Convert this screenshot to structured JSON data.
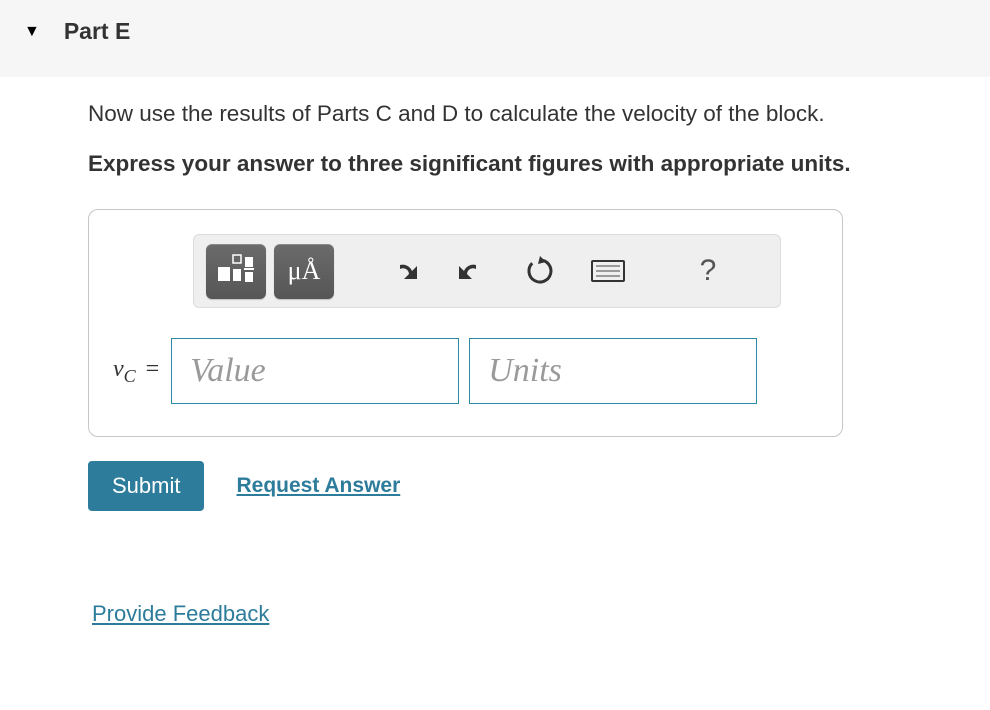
{
  "part": {
    "label": "Part E"
  },
  "question": {
    "instruction": "Now use the results of Parts C and D to calculate the velocity of the block.",
    "hint": "Express your answer to three significant figures with appropriate units."
  },
  "toolbar": {
    "templates": "templates-icon",
    "symbols_label": "μÅ",
    "undo": "undo",
    "redo": "redo",
    "reset": "reset",
    "keyboard": "keyboard",
    "help": "?"
  },
  "answer": {
    "variable": "v",
    "subscript": "C",
    "equals": "=",
    "value_placeholder": "Value",
    "units_placeholder": "Units",
    "value": "",
    "units": ""
  },
  "actions": {
    "submit": "Submit",
    "request": "Request Answer"
  },
  "footer": {
    "feedback": "Provide Feedback"
  }
}
